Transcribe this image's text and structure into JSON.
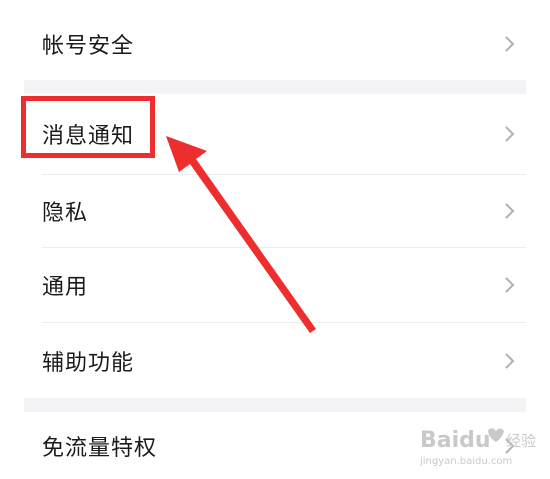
{
  "settings_items": [
    {
      "label": "帐号安全"
    },
    {
      "label": "消息通知"
    },
    {
      "label": "隐私"
    },
    {
      "label": "通用"
    },
    {
      "label": "辅助功能"
    },
    {
      "label": "免流量特权"
    }
  ],
  "annotation": {
    "highlight_color": "#ee2e2e",
    "arrow_color": "#ee2e2e"
  },
  "watermark": {
    "brand": "Baidu",
    "product": "经验",
    "url": "jingyan.baidu.com"
  }
}
